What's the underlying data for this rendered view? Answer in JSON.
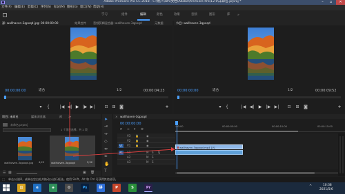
{
  "window": {
    "title": "Adobe Premiere Pro CC 2018 - C:\\用户\\zzh\\文档\\Adobe\\Premiere Pro\\12.0\\未命名.prproj *"
  },
  "menu": [
    "文件(F)",
    "编辑(E)",
    "剪辑(C)",
    "序列(S)",
    "标记(M)",
    "图形(G)",
    "窗口(W)",
    "帮助(H)"
  ],
  "workspaces": [
    "学习",
    "组件",
    "编辑",
    "颜色",
    "效果",
    "音频",
    "图形",
    "库"
  ],
  "source_monitor": {
    "tab_label": "源: wallhaven-3qpxqd.jpg: 00:00:00:00",
    "tab2": "效果控件",
    "tab3": "音频剪辑混合器: wallhaven-3qpxqd",
    "tab4": "元数据",
    "timecode": "00:00:00:00",
    "fit": "适合",
    "scale": "1/2",
    "duration": "00:00:04:23"
  },
  "program_monitor": {
    "tab_label": "节目: wallhaven-3qpxqd",
    "timecode": "00:00:00:00",
    "fit": "适合",
    "scale": "1/2",
    "duration": "00:00:09:52"
  },
  "project_panel": {
    "tab_label": "项目: 未命名",
    "tab2": "媒体浏览器",
    "tab3": "库",
    "path": "未命名.prproj",
    "item_count": "1 个项已选择，共 2 项",
    "items": [
      {
        "name": "wallhaven-3qpxqd.jpg",
        "duration": "4;23"
      },
      {
        "name": "wallhaven-3qpxqd",
        "duration": "9;52"
      }
    ]
  },
  "timeline": {
    "tab_label": "wallhaven-3qpxqd",
    "timecode": "00:00:00:00",
    "ruler": [
      ":00:00",
      "00:00:05:00",
      "00:00:10:00",
      "00:00:15:00"
    ],
    "tracks_video": [
      "V3",
      "V2",
      "V1"
    ],
    "tracks_audio": [
      "A1",
      "A2",
      "A3"
    ],
    "clip_video": "wallhaven-3qpxqd.mp4 [V]",
    "clip_audio": ""
  },
  "status_bar": "单击以选择，或单击空白处并拖动以进行框选。使用 Shift、Alt 和 Ctrl 可获得其他选项。",
  "taskbar": {
    "clock_time": "10:38",
    "clock_date": "2021/5/6",
    "icons": [
      "start",
      "explorer",
      "ie",
      "network",
      "settings",
      "photoshop",
      "ime",
      "ppt",
      "sheet",
      "premiere"
    ]
  },
  "colors": {
    "accent": "#4a9eff",
    "playhead": "#e04040",
    "clip_video": "#8fb8e8",
    "clip_audio": "#5fa0d8"
  }
}
